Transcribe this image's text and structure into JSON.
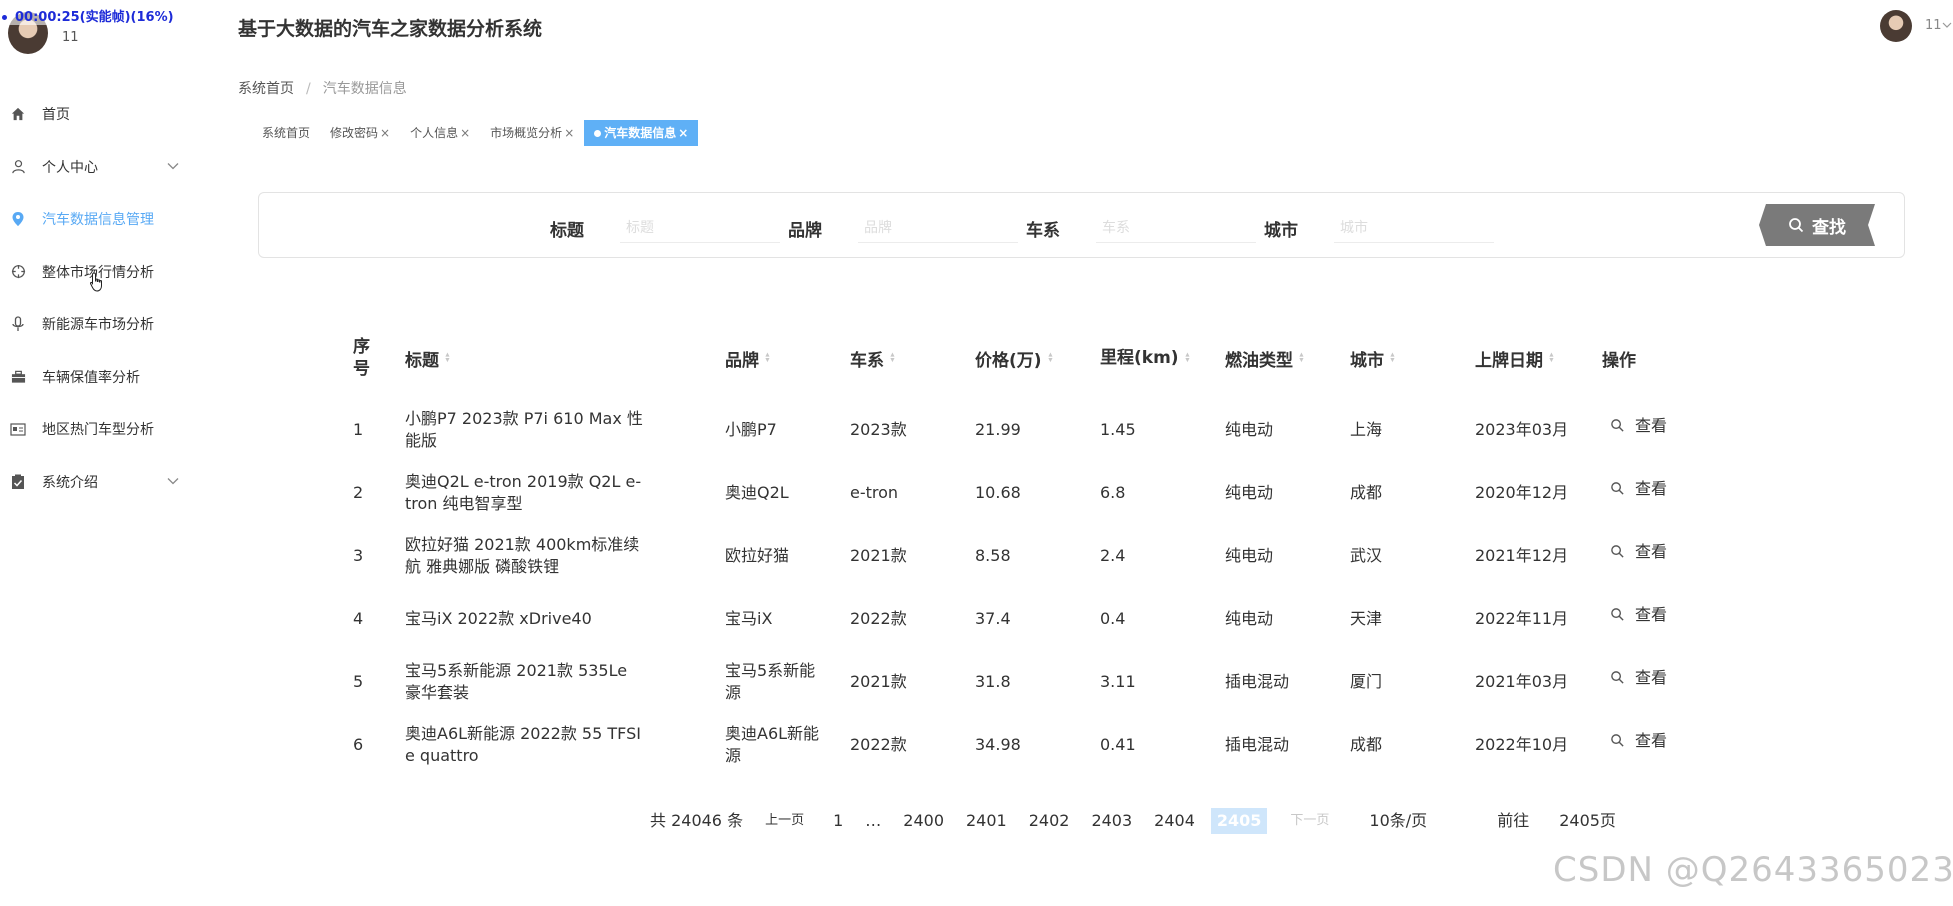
{
  "recording": {
    "text": "00:00:25(实能帧)(16%)"
  },
  "sidebar": {
    "username": "11",
    "items": [
      {
        "label": "首页",
        "icon": "home-icon"
      },
      {
        "label": "个人中心",
        "icon": "user-icon",
        "expandable": true
      },
      {
        "label": "汽车数据信息管理",
        "icon": "map-pin-icon",
        "active": true
      },
      {
        "label": "整体市场行情分析",
        "icon": "crosshair-icon"
      },
      {
        "label": "新能源车市场分析",
        "icon": "microphone-icon"
      },
      {
        "label": "车辆保值率分析",
        "icon": "briefcase-icon"
      },
      {
        "label": "地区热门车型分析",
        "icon": "id-card-icon"
      },
      {
        "label": "系统介绍",
        "icon": "clipboard-check-icon",
        "expandable": true
      }
    ]
  },
  "header": {
    "title": "基于大数据的汽车之家数据分析系统",
    "username": "11"
  },
  "breadcrumb": {
    "home": "系统首页",
    "separator": "/",
    "current": "汽车数据信息"
  },
  "tabs": [
    {
      "label": "系统首页",
      "closable": false
    },
    {
      "label": "修改密码",
      "closable": true
    },
    {
      "label": "个人信息",
      "closable": true
    },
    {
      "label": "市场概览分析",
      "closable": true
    },
    {
      "label": "汽车数据信息",
      "closable": true,
      "active": true
    }
  ],
  "search": {
    "fields": [
      {
        "label": "标题",
        "placeholder": "标题"
      },
      {
        "label": "品牌",
        "placeholder": "品牌"
      },
      {
        "label": "车系",
        "placeholder": "车系"
      },
      {
        "label": "城市",
        "placeholder": "城市"
      }
    ],
    "button_label": "查找"
  },
  "table": {
    "columns": [
      "序号",
      "标题",
      "品牌",
      "车系",
      "价格(万)",
      "里程(km)",
      "燃油类型",
      "城市",
      "上牌日期",
      "操作"
    ],
    "sortable": [
      false,
      true,
      true,
      true,
      true,
      true,
      true,
      true,
      true,
      false
    ],
    "view_label": "查看",
    "rows": [
      [
        "1",
        "小鹏P7 2023款 P7i 610 Max 性能版",
        "小鹏P7",
        "2023款",
        "21.99",
        "1.45",
        "纯电动",
        "上海",
        "2023年03月"
      ],
      [
        "2",
        "奥迪Q2L e-tron 2019款 Q2L e-tron 纯电智享型",
        "奥迪Q2L",
        "e-tron",
        "10.68",
        "6.8",
        "纯电动",
        "成都",
        "2020年12月"
      ],
      [
        "3",
        "欧拉好猫 2021款 400km标准续航 雅典娜版 磷酸铁锂",
        "欧拉好猫",
        "2021款",
        "8.58",
        "2.4",
        "纯电动",
        "武汉",
        "2021年12月"
      ],
      [
        "4",
        "宝马iX 2022款 xDrive40",
        "宝马iX",
        "2022款",
        "37.4",
        "0.4",
        "纯电动",
        "天津",
        "2022年11月"
      ],
      [
        "5",
        "宝马5系新能源 2021款 535Le 豪华套装",
        "宝马5系新能源",
        "2021款",
        "31.8",
        "3.11",
        "插电混动",
        "厦门",
        "2021年03月"
      ],
      [
        "6",
        "奥迪A6L新能源 2022款 55 TFSI e quattro",
        "奥迪A6L新能源",
        "2022款",
        "34.98",
        "0.41",
        "插电混动",
        "成都",
        "2022年10月"
      ]
    ]
  },
  "pagination": {
    "total_text": "共 24046 条",
    "prev": "上一页",
    "pages": [
      "1",
      "…",
      "2400",
      "2401",
      "2402",
      "2403",
      "2404",
      "2405"
    ],
    "current": "2405",
    "next": "下一页",
    "page_size": "10条/页",
    "goto_label": "前往",
    "goto_value": "2405页"
  },
  "watermark": "CSDN @Q2643365023"
}
